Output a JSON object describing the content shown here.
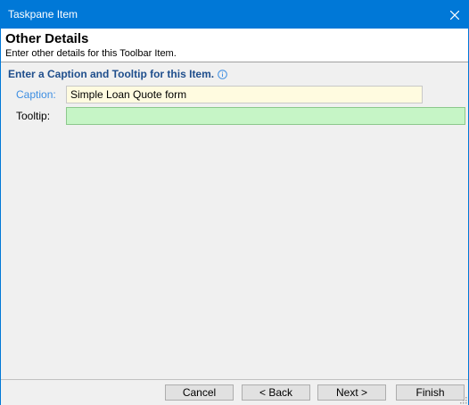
{
  "window": {
    "title": "Taskpane Item",
    "close_icon": "close-icon"
  },
  "header": {
    "title": "Other Details",
    "subtitle": "Enter other details for this Toolbar Item."
  },
  "section": {
    "title": "Enter a Caption and Tooltip for this Item.",
    "info_icon": "info-icon"
  },
  "form": {
    "caption_label": "Caption:",
    "caption_value": "Simple Loan Quote form",
    "tooltip_label": "Tooltip:",
    "tooltip_value": ""
  },
  "buttons": {
    "cancel": "Cancel",
    "back": "< Back",
    "next": "Next >",
    "finish": "Finish"
  },
  "colors": {
    "titlebar": "#0078d7",
    "section_title": "#1f4e8c",
    "caption_label": "#3d8ee2",
    "caption_field_bg": "#fffbe0",
    "tooltip_field_bg": "#c6f5c6"
  }
}
